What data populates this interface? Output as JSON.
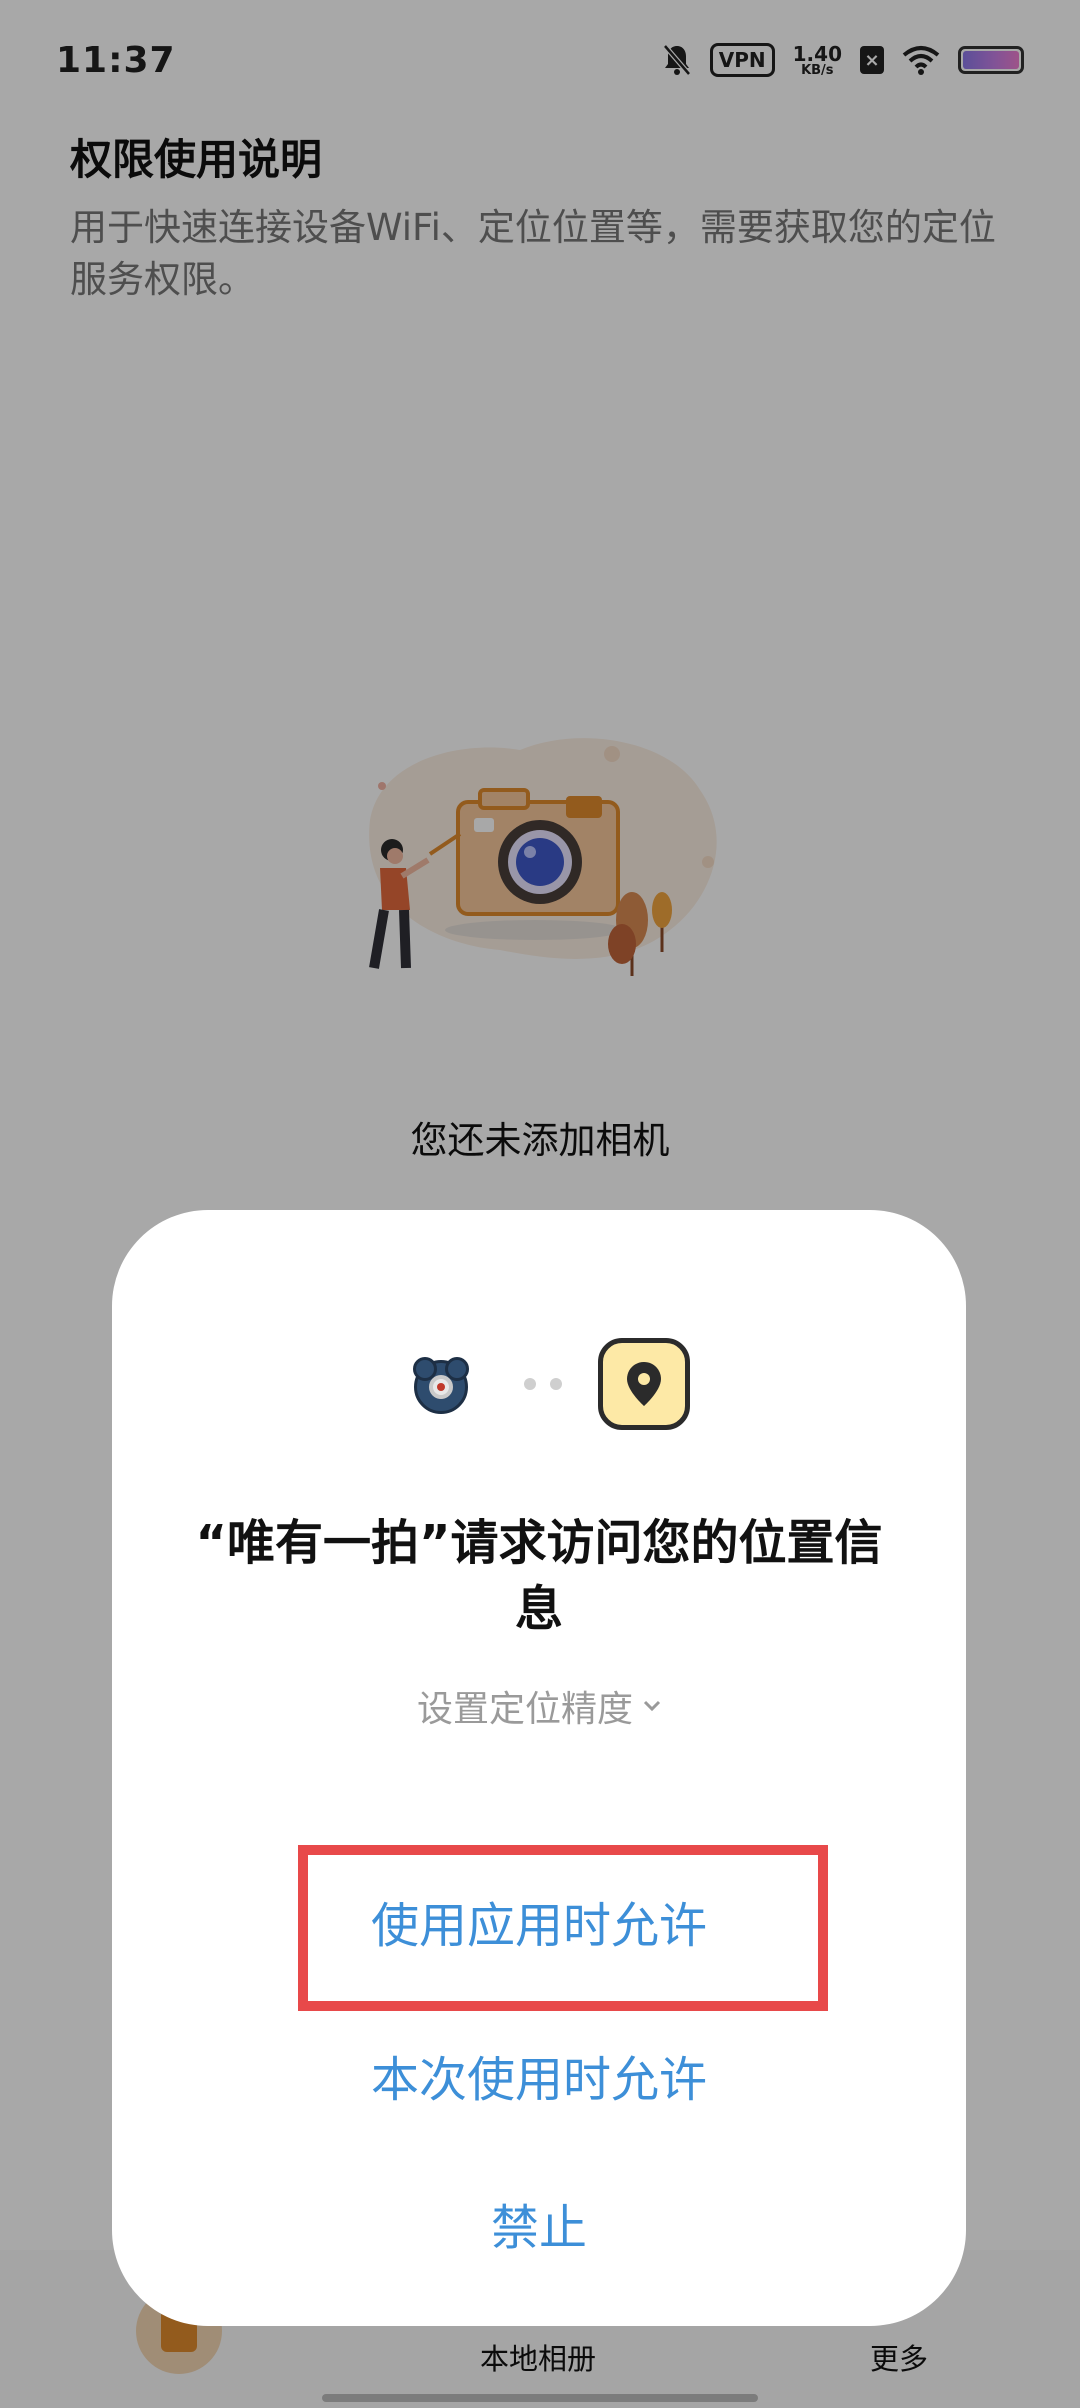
{
  "status_bar": {
    "time": "11:37",
    "vpn": "VPN",
    "net_speed_value": "1.40",
    "net_speed_unit": "KB/s",
    "icons": [
      "bell-muted-icon",
      "vpn-icon",
      "notification-x-icon",
      "wifi-icon",
      "battery-icon"
    ]
  },
  "permission_note": {
    "title": "权限使用说明",
    "description": "用于快速连接设备WiFi、定位位置等，需要获取您的定位服务权限。"
  },
  "empty_state": {
    "message": "您还未添加相机",
    "illustration": "person-with-camera-illustration"
  },
  "bottom_nav": {
    "items": [
      {
        "label": "",
        "icon": "camera-tab-icon"
      },
      {
        "label": "本地相册"
      },
      {
        "label": "更多"
      }
    ]
  },
  "permission_dialog": {
    "title": "“唯有一拍”请求访问您的位置信息",
    "precision_label": "设置定位精度",
    "buttons": {
      "allow_while_using": "使用应用时允许",
      "allow_once": "本次使用时允许",
      "deny": "禁止"
    },
    "icons": [
      "app-bear-camera-icon",
      "location-pin-icon"
    ]
  },
  "colors": {
    "accent": "#3d8fd8",
    "highlight": "#e8494a",
    "illustration_orange": "#e08b2d",
    "location_icon_bg": "#fde9a6"
  }
}
